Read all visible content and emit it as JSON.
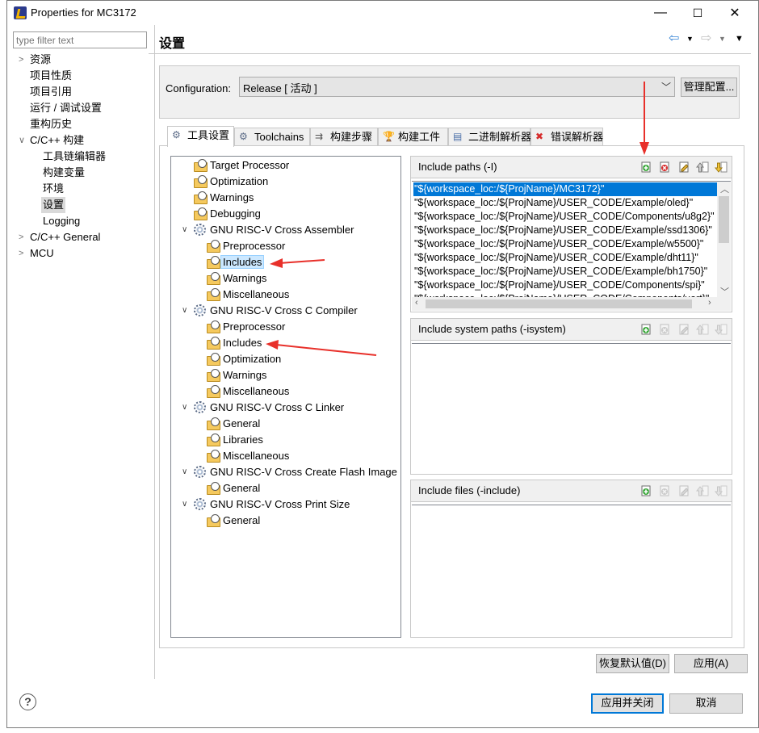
{
  "window": {
    "title": "Properties for MC3172",
    "min": "—",
    "max": "☐",
    "close": "✕"
  },
  "filter": {
    "placeholder": "type filter text"
  },
  "nav": [
    {
      "label": "资源",
      "indent": 0,
      "arrow": ">"
    },
    {
      "label": "项目性质",
      "indent": 0,
      "arrow": ""
    },
    {
      "label": "项目引用",
      "indent": 0,
      "arrow": ""
    },
    {
      "label": "运行 / 调试设置",
      "indent": 0,
      "arrow": ""
    },
    {
      "label": "重构历史",
      "indent": 0,
      "arrow": ""
    },
    {
      "label": "C/C++ 构建",
      "indent": 0,
      "arrow": "v"
    },
    {
      "label": "工具链编辑器",
      "indent": 1,
      "arrow": ""
    },
    {
      "label": "构建变量",
      "indent": 1,
      "arrow": ""
    },
    {
      "label": "环境",
      "indent": 1,
      "arrow": ""
    },
    {
      "label": "设置",
      "indent": 1,
      "arrow": "",
      "selected": true
    },
    {
      "label": "Logging",
      "indent": 1,
      "arrow": ""
    },
    {
      "label": "C/C++ General",
      "indent": 0,
      "arrow": ">"
    },
    {
      "label": "MCU",
      "indent": 0,
      "arrow": ">"
    }
  ],
  "header": {
    "title": "设置"
  },
  "configuration": {
    "label": "Configuration:",
    "value": "Release  [ 活动 ]",
    "manage_label": "管理配置..."
  },
  "tabs": [
    {
      "label": "工具设置",
      "icon": "tool-settings-icon"
    },
    {
      "label": "Toolchains",
      "icon": "toolchains-icon"
    },
    {
      "label": "构建步骤",
      "icon": "build-steps-icon"
    },
    {
      "label": "构建工件",
      "icon": "build-artifact-icon"
    },
    {
      "label": "二进制解析器",
      "icon": "binary-parser-icon"
    },
    {
      "label": "错误解析器",
      "icon": "error-parser-icon"
    }
  ],
  "tree": [
    {
      "label": "Target Processor",
      "level": 0,
      "kind": "folder"
    },
    {
      "label": "Optimization",
      "level": 0,
      "kind": "folder"
    },
    {
      "label": "Warnings",
      "level": 0,
      "kind": "folder"
    },
    {
      "label": "Debugging",
      "level": 0,
      "kind": "folder"
    },
    {
      "label": "GNU RISC-V Cross Assembler",
      "level": 0,
      "kind": "gear",
      "expanded": true
    },
    {
      "label": "Preprocessor",
      "level": 1,
      "kind": "folder"
    },
    {
      "label": "Includes",
      "level": 1,
      "kind": "folder",
      "selected": true
    },
    {
      "label": "Warnings",
      "level": 1,
      "kind": "folder"
    },
    {
      "label": "Miscellaneous",
      "level": 1,
      "kind": "folder"
    },
    {
      "label": "GNU RISC-V Cross C Compiler",
      "level": 0,
      "kind": "gear",
      "expanded": true
    },
    {
      "label": "Preprocessor",
      "level": 1,
      "kind": "folder"
    },
    {
      "label": "Includes",
      "level": 1,
      "kind": "folder"
    },
    {
      "label": "Optimization",
      "level": 1,
      "kind": "folder"
    },
    {
      "label": "Warnings",
      "level": 1,
      "kind": "folder"
    },
    {
      "label": "Miscellaneous",
      "level": 1,
      "kind": "folder"
    },
    {
      "label": "GNU RISC-V Cross C Linker",
      "level": 0,
      "kind": "gear",
      "expanded": true
    },
    {
      "label": "General",
      "level": 1,
      "kind": "folder"
    },
    {
      "label": "Libraries",
      "level": 1,
      "kind": "folder"
    },
    {
      "label": "Miscellaneous",
      "level": 1,
      "kind": "folder"
    },
    {
      "label": "GNU RISC-V Cross Create Flash Image",
      "level": 0,
      "kind": "gear",
      "expanded": true
    },
    {
      "label": "General",
      "level": 1,
      "kind": "folder"
    },
    {
      "label": "GNU RISC-V Cross Print Size",
      "level": 0,
      "kind": "gear",
      "expanded": true
    },
    {
      "label": "General",
      "level": 1,
      "kind": "folder"
    }
  ],
  "include_paths": {
    "title": "Include paths (-I)",
    "items": [
      "\"${workspace_loc:/${ProjName}/MC3172}\"",
      "\"${workspace_loc:/${ProjName}/USER_CODE/Example/oled}\"",
      "\"${workspace_loc:/${ProjName}/USER_CODE/Components/u8g2}\"",
      "\"${workspace_loc:/${ProjName}/USER_CODE/Example/ssd1306}\"",
      "\"${workspace_loc:/${ProjName}/USER_CODE/Example/w5500}\"",
      "\"${workspace_loc:/${ProjName}/USER_CODE/Example/dht11}\"",
      "\"${workspace_loc:/${ProjName}/USER_CODE/Example/bh1750}\"",
      "\"${workspace_loc:/${ProjName}/USER_CODE/Components/spi}\"",
      "\"${workspace_loc:/${ProjName}/USER_CODE/Components/uart}\""
    ]
  },
  "system_paths": {
    "title": "Include system paths (-isystem)"
  },
  "include_files": {
    "title": "Include files (-include)"
  },
  "buttons": {
    "restore": "恢复默认值(D)",
    "apply": "应用(A)",
    "apply_close": "应用并关闭",
    "cancel": "取消"
  },
  "colors": {
    "selection": "#0078d7",
    "annotation_arrow": "#e8302a",
    "tree_selection": "#cce8ff"
  }
}
